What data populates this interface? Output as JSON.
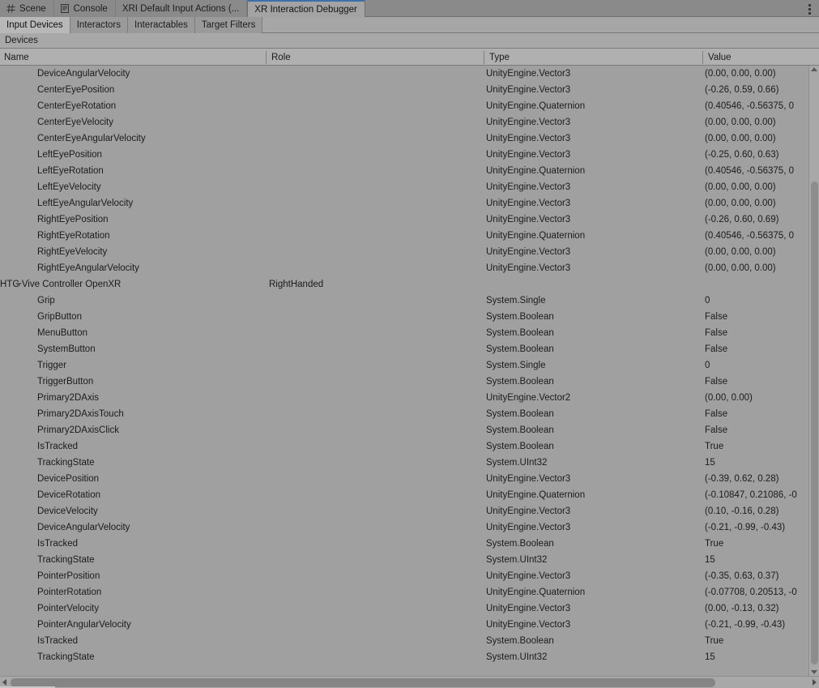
{
  "window": {
    "tabs": [
      {
        "label": "Scene",
        "icon": "grid-icon",
        "active": false
      },
      {
        "label": "Console",
        "icon": "console-icon",
        "active": false
      },
      {
        "label": "XRI Default Input Actions (...",
        "icon": "none",
        "active": false
      },
      {
        "label": "XR Interaction Debugger",
        "icon": "none",
        "active": true
      }
    ],
    "menu_icon": "kebab-menu-icon"
  },
  "subtabs": [
    {
      "label": "Input Devices",
      "active": true
    },
    {
      "label": "Interactors",
      "active": false
    },
    {
      "label": "Interactables",
      "active": false
    },
    {
      "label": "Target Filters",
      "active": false
    }
  ],
  "section": {
    "title": "Devices"
  },
  "columns": [
    {
      "label": "Name"
    },
    {
      "label": "Role"
    },
    {
      "label": "Type"
    },
    {
      "label": "Value"
    }
  ],
  "colors": {
    "accent": "#3f6fa8",
    "window_bg": "#a0a0a0",
    "tabbar_bg": "#8a8a8a",
    "header_bg": "#b0b0b0",
    "active_tab_bg": "#a3a3a3",
    "scrollbar_thumb": "#8d8d8d",
    "text": "#1b1b1b"
  },
  "rows": [
    {
      "indent": "child",
      "name": "DeviceAngularVelocity",
      "role": "",
      "type": "UnityEngine.Vector3",
      "value": "(0.00, 0.00, 0.00)"
    },
    {
      "indent": "child",
      "name": "CenterEyePosition",
      "role": "",
      "type": "UnityEngine.Vector3",
      "value": "(-0.26, 0.59, 0.66)"
    },
    {
      "indent": "child",
      "name": "CenterEyeRotation",
      "role": "",
      "type": "UnityEngine.Quaternion",
      "value": "(0.40546, -0.56375, 0"
    },
    {
      "indent": "child",
      "name": "CenterEyeVelocity",
      "role": "",
      "type": "UnityEngine.Vector3",
      "value": "(0.00, 0.00, 0.00)"
    },
    {
      "indent": "child",
      "name": "CenterEyeAngularVelocity",
      "role": "",
      "type": "UnityEngine.Vector3",
      "value": "(0.00, 0.00, 0.00)"
    },
    {
      "indent": "child",
      "name": "LeftEyePosition",
      "role": "",
      "type": "UnityEngine.Vector3",
      "value": "(-0.25, 0.60, 0.63)"
    },
    {
      "indent": "child",
      "name": "LeftEyeRotation",
      "role": "",
      "type": "UnityEngine.Quaternion",
      "value": "(0.40546, -0.56375, 0"
    },
    {
      "indent": "child",
      "name": "LeftEyeVelocity",
      "role": "",
      "type": "UnityEngine.Vector3",
      "value": "(0.00, 0.00, 0.00)"
    },
    {
      "indent": "child",
      "name": "LeftEyeAngularVelocity",
      "role": "",
      "type": "UnityEngine.Vector3",
      "value": "(0.00, 0.00, 0.00)"
    },
    {
      "indent": "child",
      "name": "RightEyePosition",
      "role": "",
      "type": "UnityEngine.Vector3",
      "value": "(-0.26, 0.60, 0.69)"
    },
    {
      "indent": "child",
      "name": "RightEyeRotation",
      "role": "",
      "type": "UnityEngine.Quaternion",
      "value": "(0.40546, -0.56375, 0"
    },
    {
      "indent": "child",
      "name": "RightEyeVelocity",
      "role": "",
      "type": "UnityEngine.Vector3",
      "value": "(0.00, 0.00, 0.00)"
    },
    {
      "indent": "child",
      "name": "RightEyeAngularVelocity",
      "role": "",
      "type": "UnityEngine.Vector3",
      "value": "(0.00, 0.00, 0.00)"
    },
    {
      "indent": "group",
      "name": "HTC Vive Controller OpenXR",
      "role": "RightHanded",
      "type": "",
      "value": "",
      "expanded": true
    },
    {
      "indent": "child",
      "name": "Grip",
      "role": "",
      "type": "System.Single",
      "value": "0"
    },
    {
      "indent": "child",
      "name": "GripButton",
      "role": "",
      "type": "System.Boolean",
      "value": "False"
    },
    {
      "indent": "child",
      "name": "MenuButton",
      "role": "",
      "type": "System.Boolean",
      "value": "False"
    },
    {
      "indent": "child",
      "name": "SystemButton",
      "role": "",
      "type": "System.Boolean",
      "value": "False"
    },
    {
      "indent": "child",
      "name": "Trigger",
      "role": "",
      "type": "System.Single",
      "value": "0"
    },
    {
      "indent": "child",
      "name": "TriggerButton",
      "role": "",
      "type": "System.Boolean",
      "value": "False"
    },
    {
      "indent": "child",
      "name": "Primary2DAxis",
      "role": "",
      "type": "UnityEngine.Vector2",
      "value": "(0.00, 0.00)"
    },
    {
      "indent": "child",
      "name": "Primary2DAxisTouch",
      "role": "",
      "type": "System.Boolean",
      "value": "False"
    },
    {
      "indent": "child",
      "name": "Primary2DAxisClick",
      "role": "",
      "type": "System.Boolean",
      "value": "False"
    },
    {
      "indent": "child",
      "name": "IsTracked",
      "role": "",
      "type": "System.Boolean",
      "value": "True"
    },
    {
      "indent": "child",
      "name": "TrackingState",
      "role": "",
      "type": "System.UInt32",
      "value": "15"
    },
    {
      "indent": "child",
      "name": "DevicePosition",
      "role": "",
      "type": "UnityEngine.Vector3",
      "value": "(-0.39, 0.62, 0.28)"
    },
    {
      "indent": "child",
      "name": "DeviceRotation",
      "role": "",
      "type": "UnityEngine.Quaternion",
      "value": "(-0.10847, 0.21086, -0"
    },
    {
      "indent": "child",
      "name": "DeviceVelocity",
      "role": "",
      "type": "UnityEngine.Vector3",
      "value": "(0.10, -0.16, 0.28)"
    },
    {
      "indent": "child",
      "name": "DeviceAngularVelocity",
      "role": "",
      "type": "UnityEngine.Vector3",
      "value": "(-0.21, -0.99, -0.43)"
    },
    {
      "indent": "child",
      "name": "IsTracked",
      "role": "",
      "type": "System.Boolean",
      "value": "True"
    },
    {
      "indent": "child",
      "name": "TrackingState",
      "role": "",
      "type": "System.UInt32",
      "value": "15"
    },
    {
      "indent": "child",
      "name": "PointerPosition",
      "role": "",
      "type": "UnityEngine.Vector3",
      "value": "(-0.35, 0.63, 0.37)"
    },
    {
      "indent": "child",
      "name": "PointerRotation",
      "role": "",
      "type": "UnityEngine.Quaternion",
      "value": "(-0.07708, 0.20513, -0"
    },
    {
      "indent": "child",
      "name": "PointerVelocity",
      "role": "",
      "type": "UnityEngine.Vector3",
      "value": "(0.00, -0.13, 0.32)"
    },
    {
      "indent": "child",
      "name": "PointerAngularVelocity",
      "role": "",
      "type": "UnityEngine.Vector3",
      "value": "(-0.21, -0.99, -0.43)"
    },
    {
      "indent": "child",
      "name": "IsTracked",
      "role": "",
      "type": "System.Boolean",
      "value": "True"
    },
    {
      "indent": "child",
      "name": "TrackingState",
      "role": "",
      "type": "System.UInt32",
      "value": "15"
    }
  ],
  "scrollbars": {
    "vertical": {
      "thumb_top_pct": 19,
      "thumb_height_pct": 81,
      "up_arrow_icon": "caret-up-icon",
      "down_arrow_icon": "caret-down-icon"
    },
    "horizontal": {
      "thumb_left_pct": 1.3,
      "thumb_width_pct": 86,
      "left_arrow_icon": "caret-left-icon",
      "right_arrow_icon": "caret-right-icon"
    }
  }
}
